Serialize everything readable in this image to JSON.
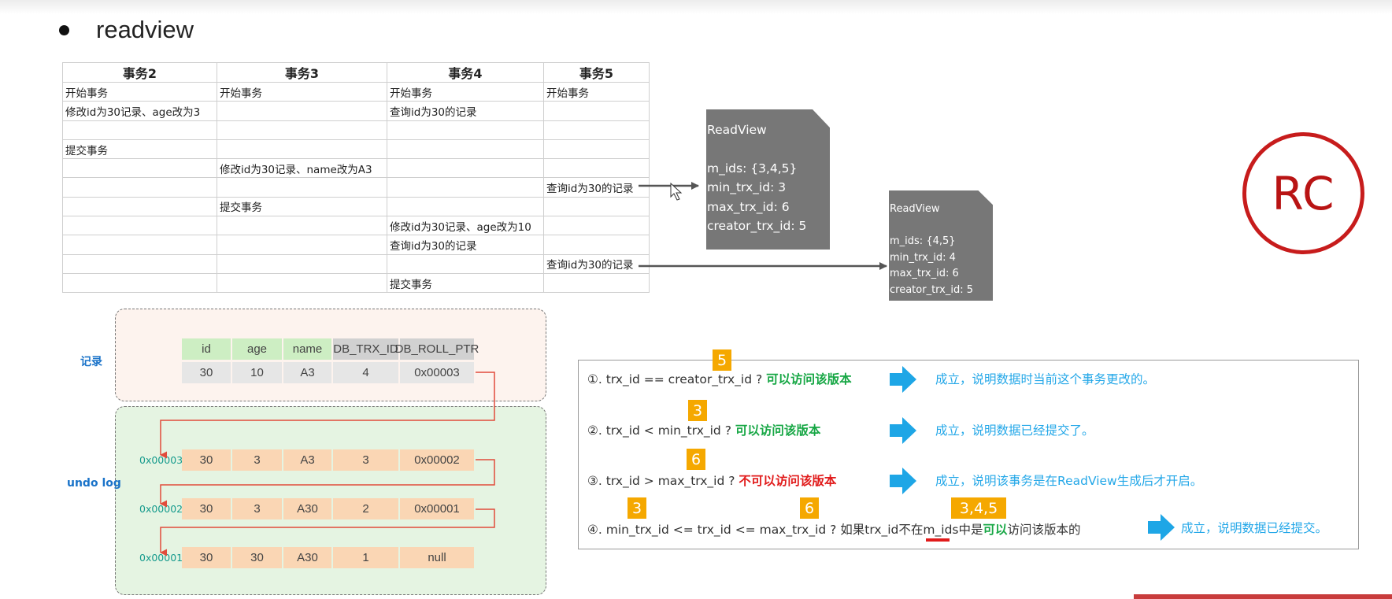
{
  "heading": "readview",
  "txn_table": {
    "headers": [
      "事务2",
      "事务3",
      "事务4",
      "事务5"
    ],
    "rows": [
      [
        "开始事务",
        "开始事务",
        "开始事务",
        "开始事务"
      ],
      [
        "修改id为30记录、age改为3",
        "",
        "查询id为30的记录",
        ""
      ],
      [
        "",
        "",
        "",
        ""
      ],
      [
        "提交事务",
        "",
        "",
        ""
      ],
      [
        "",
        "修改id为30记录、name改为A3",
        "",
        ""
      ],
      [
        "",
        "",
        "",
        "查询id为30的记录"
      ],
      [
        "",
        "提交事务",
        "",
        ""
      ],
      [
        "",
        "",
        "修改id为30记录、age改为10",
        ""
      ],
      [
        "",
        "",
        "查询id为30的记录",
        ""
      ],
      [
        "",
        "",
        "",
        "查询id为30的记录"
      ],
      [
        "",
        "",
        "提交事务",
        ""
      ]
    ]
  },
  "readview_1": {
    "title": "ReadView",
    "m_ids": "m_ids: {3,4,5}",
    "min_trx_id": "min_trx_id: 3",
    "max_trx_id": "max_trx_id: 6",
    "creator_trx_id": "creator_trx_id: 5"
  },
  "readview_2": {
    "title": "ReadView",
    "m_ids": "m_ids: {4,5}",
    "min_trx_id": "min_trx_id: 4",
    "max_trx_id": "max_trx_id: 6",
    "creator_trx_id": "creator_trx_id: 5"
  },
  "rc_badge": "RC",
  "record": {
    "label": "记录",
    "columns": [
      "id",
      "age",
      "name",
      "DB_TRX_ID",
      "DB_ROLL_PTR"
    ],
    "values": [
      "30",
      "10",
      "A3",
      "4",
      "0x00003"
    ]
  },
  "undo_log": {
    "label": "undo log",
    "rows": [
      {
        "addr": "0x00003",
        "cells": [
          "30",
          "3",
          "A3",
          "3",
          "0x00002"
        ]
      },
      {
        "addr": "0x00002",
        "cells": [
          "30",
          "3",
          "A30",
          "2",
          "0x00001"
        ]
      },
      {
        "addr": "0x00001",
        "cells": [
          "30",
          "30",
          "A30",
          "1",
          "null"
        ]
      }
    ]
  },
  "rules": {
    "r1": {
      "condition": "①. trx_id  == creator_trx_id ?",
      "verdict": "可以访问该版本",
      "result": "成立，说明数据时当前这个事务更改的。",
      "badge": "5"
    },
    "r2": {
      "condition": "②. trx_id < min_trx_id ?",
      "verdict": "可以访问该版本",
      "result": "成立，说明数据已经提交了。",
      "badge": "3"
    },
    "r3": {
      "condition": "③. trx_id > max_trx_id ?",
      "verdict": "不可以访问该版本",
      "result": "成立，说明该事务是在ReadView生成后才开启。",
      "badge": "6"
    },
    "r4": {
      "part1": "④. min_trx_id <= trx_id <= max_trx_id ?  如果trx_id",
      "part2": "不在",
      "part3": "m_ids中是",
      "part4": "可以",
      "part5": "访问该版本的",
      "result": "成立，说明数据已经提交。",
      "badge_a": "3",
      "badge_b": "6",
      "badge_c": "3,4,5"
    }
  },
  "colors": {
    "readview_bg": "#777777",
    "rc_red": "#c71c1c",
    "green_text": "#17a745",
    "red_text": "#e11b1b",
    "result_blue": "#23a7e8",
    "badge_orange": "#f5a800"
  }
}
